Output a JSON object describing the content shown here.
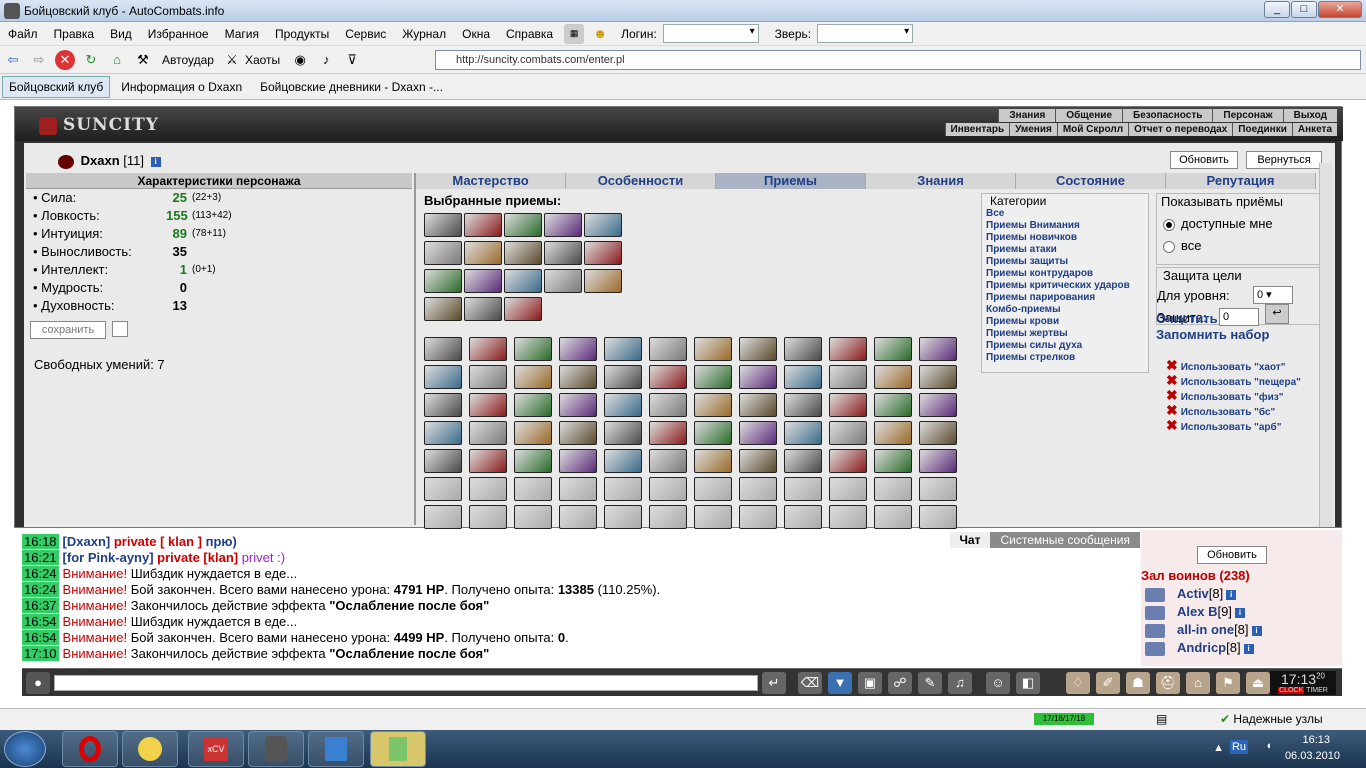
{
  "window": {
    "title": "Бойцовский клуб - AutoCombats.info"
  },
  "menu": {
    "items": [
      "Файл",
      "Правка",
      "Вид",
      "Избранное",
      "Магия",
      "Продукты",
      "Сервис",
      "Журнал",
      "Окна",
      "Справка"
    ],
    "login_label": "Логин:",
    "beast_label": "Зверь:"
  },
  "toolbar": {
    "autoudar": "Автоудар",
    "haoty": "Хаоты",
    "url": "http://suncity.combats.com/enter.pl"
  },
  "tabs": [
    "Бойцовский клуб",
    "Информация о Dxaxn",
    "Бойцовские дневники - Dxaxn -..."
  ],
  "game": {
    "logo": "SUNCITY",
    "nav_top": [
      "Знания",
      "Общение",
      "Безопасность",
      "Персонаж",
      "Выход"
    ],
    "nav_bottom": [
      "Инвентарь",
      "Умения",
      "Мой Скролл",
      "Отчет о переводах",
      "Поединки",
      "Анкета"
    ],
    "nick": "Dxaxn",
    "level": "[11]",
    "refresh": "Обновить",
    "back": "Вернуться",
    "stats_title": "Характеристики персонажа",
    "stats": [
      {
        "name": "Сила:",
        "value": "25",
        "extra": "(22+3)"
      },
      {
        "name": "Ловкость:",
        "value": "155",
        "extra": "(113+42)"
      },
      {
        "name": "Интуиция:",
        "value": "89",
        "extra": "(78+11)"
      },
      {
        "name": "Выносливость:",
        "value": "35",
        "extra": ""
      },
      {
        "name": "Интеллект:",
        "value": "1",
        "extra": "(0+1)"
      },
      {
        "name": "Мудрость:",
        "value": "0",
        "extra": ""
      },
      {
        "name": "Духовность:",
        "value": "13",
        "extra": ""
      }
    ],
    "save": "сохранить",
    "free_skills": "Свободных умений: 7",
    "skill_tabs": [
      "Мастерство",
      "Особенности",
      "Приемы",
      "Знания",
      "Состояние",
      "Репутация"
    ],
    "selected_title": "Выбранные приемы:",
    "categories_title": "Категории",
    "categories": [
      "Все",
      "Приемы Внимания",
      "Приемы новичков",
      "Приемы атаки",
      "Приемы защиты",
      "Приемы контрударов",
      "Приемы критических ударов",
      "Приемы парирования",
      "Комбо-приемы",
      "Приемы крови",
      "Приемы жертвы",
      "Приемы силы духа",
      "Приемы стрелков"
    ],
    "show_title": "Показывать приёмы",
    "show_opts": [
      "доступные мне",
      "все"
    ],
    "protect_title": "Защита цели",
    "for_level": "Для уровня:",
    "level_value": "0",
    "protect_label": "Защита:",
    "protect_value": "0",
    "clear": "Очистить",
    "remember": "Запомнить набор",
    "use_links": [
      "Использовать \"хаот\"",
      "Использовать \"пещера\"",
      "Использовать \"физ\"",
      "Использовать \"бс\"",
      "Использовать \"арб\""
    ]
  },
  "chat": {
    "tabs": [
      "Чат",
      "Системные сообщения"
    ],
    "lines": [
      {
        "time": "16:18",
        "parts": [
          [
            "blu",
            "[Dxaxn] "
          ],
          [
            "red",
            "private [ klan ] "
          ],
          [
            "blu",
            "прю)"
          ]
        ]
      },
      {
        "time": "16:21",
        "parts": [
          [
            "blu",
            "[for Pink-ayny] "
          ],
          [
            "red",
            "private [klan] "
          ],
          [
            "pur",
            "privet :)"
          ]
        ]
      },
      {
        "time": "16:24",
        "parts": [
          [
            "red",
            "Внимание! "
          ],
          [
            "n",
            "Шибздик нуждается в еде..."
          ]
        ]
      },
      {
        "time": "16:24",
        "parts": [
          [
            "red",
            "Внимание! "
          ],
          [
            "n",
            "Бой закончен. Всего вами нанесено урона: "
          ],
          [
            "b",
            "4791 HP"
          ],
          [
            "n",
            ". Получено опыта: "
          ],
          [
            "b",
            "13385"
          ],
          [
            "n",
            " (110.25%)."
          ]
        ]
      },
      {
        "time": "16:37",
        "parts": [
          [
            "red",
            "Внимание! "
          ],
          [
            "n",
            "Закончилось действие эффекта "
          ],
          [
            "b",
            "\"Ослабление после боя\""
          ]
        ]
      },
      {
        "time": "16:54",
        "parts": [
          [
            "red",
            "Внимание! "
          ],
          [
            "n",
            "Шибздик нуждается в еде..."
          ]
        ]
      },
      {
        "time": "16:54",
        "parts": [
          [
            "red",
            "Внимание! "
          ],
          [
            "n",
            "Бой закончен. Всего вами нанесено урона: "
          ],
          [
            "b",
            "4499 HP"
          ],
          [
            "n",
            ". Получено опыта: "
          ],
          [
            "b",
            "0"
          ],
          [
            "n",
            "."
          ]
        ]
      },
      {
        "time": "17:10",
        "parts": [
          [
            "red",
            "Внимание! "
          ],
          [
            "n",
            "Закончилось действие эффекта "
          ],
          [
            "b",
            "\"Ослабление после боя\""
          ]
        ]
      }
    ]
  },
  "online": {
    "refresh": "Обновить",
    "hall": "Зал воинов (238)",
    "players": [
      {
        "name": "Activ",
        "level": "[8]"
      },
      {
        "name": "Alex B",
        "level": "[9]"
      },
      {
        "name": "all-in one",
        "level": "[8]"
      },
      {
        "name": "Andricp",
        "level": "[8]"
      }
    ]
  },
  "clock": {
    "time": "17:13",
    "sec": "20",
    "clock_label": "CLOCK",
    "timer_label": "TIMER"
  },
  "status": {
    "counter": "17/18/17/18",
    "trusted": "Надежные узлы"
  },
  "taskbar": {
    "lang": "Ru",
    "time": "16:13",
    "date": "06.03.2010"
  },
  "colors": {
    "accent": "#1f3f86",
    "alert": "#cc0000",
    "time_bg": "#33cc66"
  }
}
